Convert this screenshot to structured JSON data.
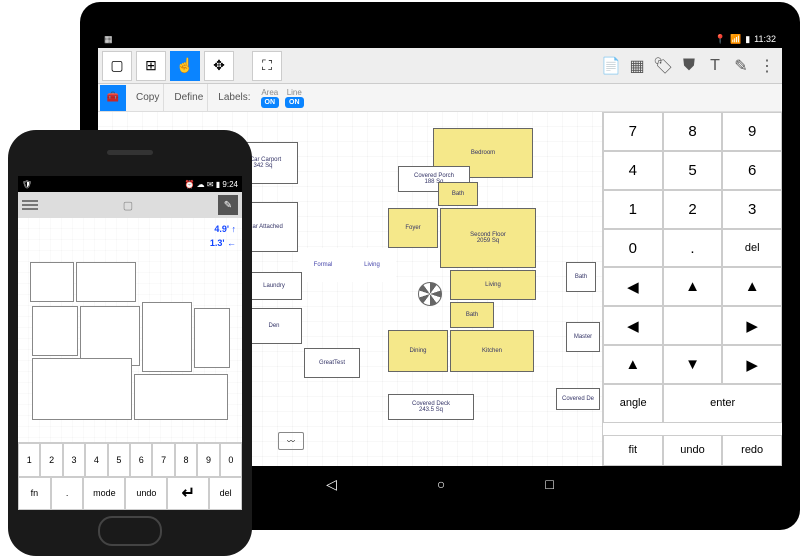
{
  "tablet": {
    "status": {
      "time": "11:32",
      "icons": [
        "gps",
        "wifi",
        "signal",
        "battery"
      ]
    },
    "toolbar": {
      "tools": [
        "select",
        "grid",
        "pan",
        "rotate",
        "",
        "crop"
      ],
      "right_icons": [
        "document",
        "grid-table",
        "tag",
        "stamp",
        "text",
        "brush",
        "menu"
      ]
    },
    "subbar": {
      "copy": "Copy",
      "define": "Define",
      "labels": "Labels:",
      "area": "Area",
      "line": "Line",
      "on": "ON"
    },
    "rooms_white": [
      {
        "name": "2 Car Carport",
        "sub": "342 Sq"
      },
      {
        "name": "Covered Porch",
        "sub": "188 Sq"
      },
      {
        "name": "2 Car Attached",
        "sub": ""
      },
      {
        "name": "Formal",
        "sub": ""
      },
      {
        "name": "Living",
        "sub": ""
      },
      {
        "name": "Laundry",
        "sub": ""
      },
      {
        "name": "Den",
        "sub": ""
      },
      {
        "name": "GreatTest",
        "sub": ""
      },
      {
        "name": "Covered Deck",
        "sub": "243.5 Sq"
      },
      {
        "name": "Bath",
        "sub": ""
      },
      {
        "name": "Master",
        "sub": ""
      },
      {
        "name": "Covered De",
        "sub": ""
      }
    ],
    "rooms_yellow": [
      {
        "name": "Bedroom"
      },
      {
        "name": "Bath"
      },
      {
        "name": "Foyer"
      },
      {
        "name": "Second Floor",
        "sub": "2059 Sq"
      },
      {
        "name": "Living"
      },
      {
        "name": "Bath"
      },
      {
        "name": "Dining"
      },
      {
        "name": "Kitchen"
      }
    ],
    "keypad": {
      "r1": [
        "7",
        "8",
        "9"
      ],
      "r2": [
        "4",
        "5",
        "6"
      ],
      "r3": [
        "1",
        "2",
        "3"
      ],
      "r4": [
        "0",
        ".",
        "del"
      ],
      "angle": "angle",
      "enter": "enter",
      "fit": "fit",
      "undo": "undo",
      "redo": "redo"
    }
  },
  "phone": {
    "status": {
      "time": "9:24"
    },
    "overlay": {
      "v1": "4.9'",
      "v2": "1.3'"
    },
    "keyboard": {
      "nums": [
        "1",
        "2",
        "3",
        "4",
        "5",
        "6",
        "7",
        "8",
        "9",
        "0"
      ],
      "bottom": [
        "fn",
        ".",
        "mode",
        "undo",
        "↵",
        "del"
      ]
    }
  }
}
